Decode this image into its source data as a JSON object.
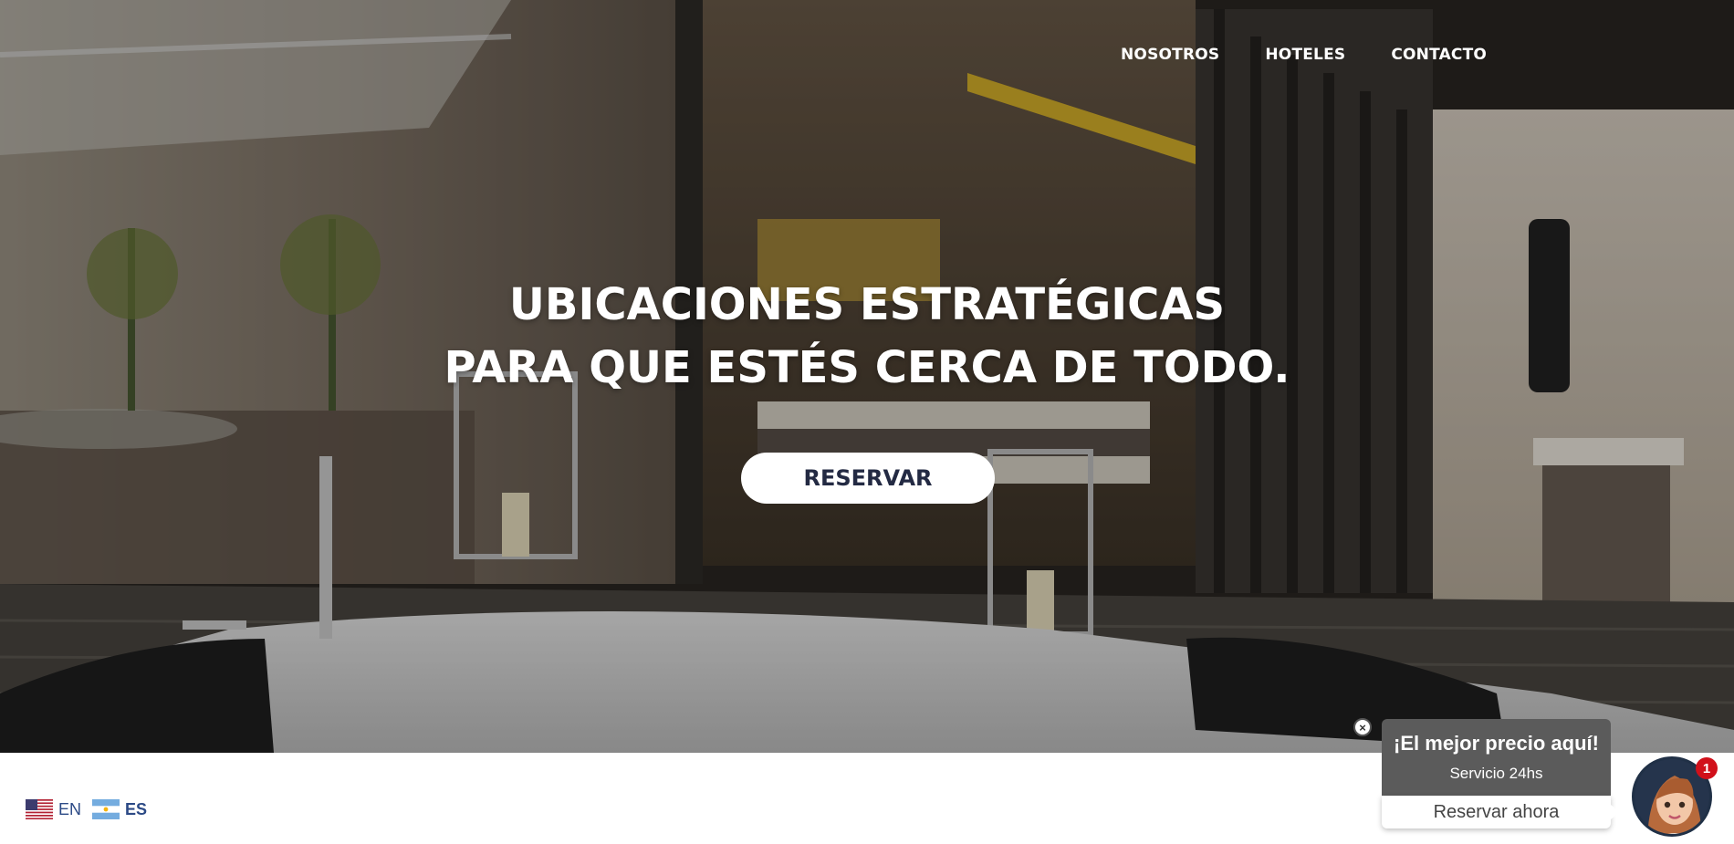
{
  "nav": {
    "items": [
      {
        "label": "NOSOTROS"
      },
      {
        "label": "HOTELES"
      },
      {
        "label": "CONTACTO"
      }
    ]
  },
  "hero": {
    "headline_line1": "UBICACIONES ESTRATÉGICAS",
    "headline_line2": "PARA QUE ESTÉS CERCA DE TODO.",
    "cta_label": "RESERVAR"
  },
  "language": {
    "options": [
      {
        "code": "EN",
        "flag": "us-flag-icon",
        "active": false
      },
      {
        "code": "ES",
        "flag": "argentina-flag-icon",
        "active": true
      }
    ]
  },
  "chat_widget": {
    "title": "¡El mejor precio aquí!",
    "subtitle": "Servicio 24hs",
    "action_label": "Reservar ahora",
    "close_symbol": "×",
    "badge_count": "1"
  },
  "colors": {
    "cta_text": "#232a43",
    "chat_bubble_bg": "#5b5b5b",
    "badge_bg": "#d1101a",
    "lang_text": "#2c4a86"
  }
}
